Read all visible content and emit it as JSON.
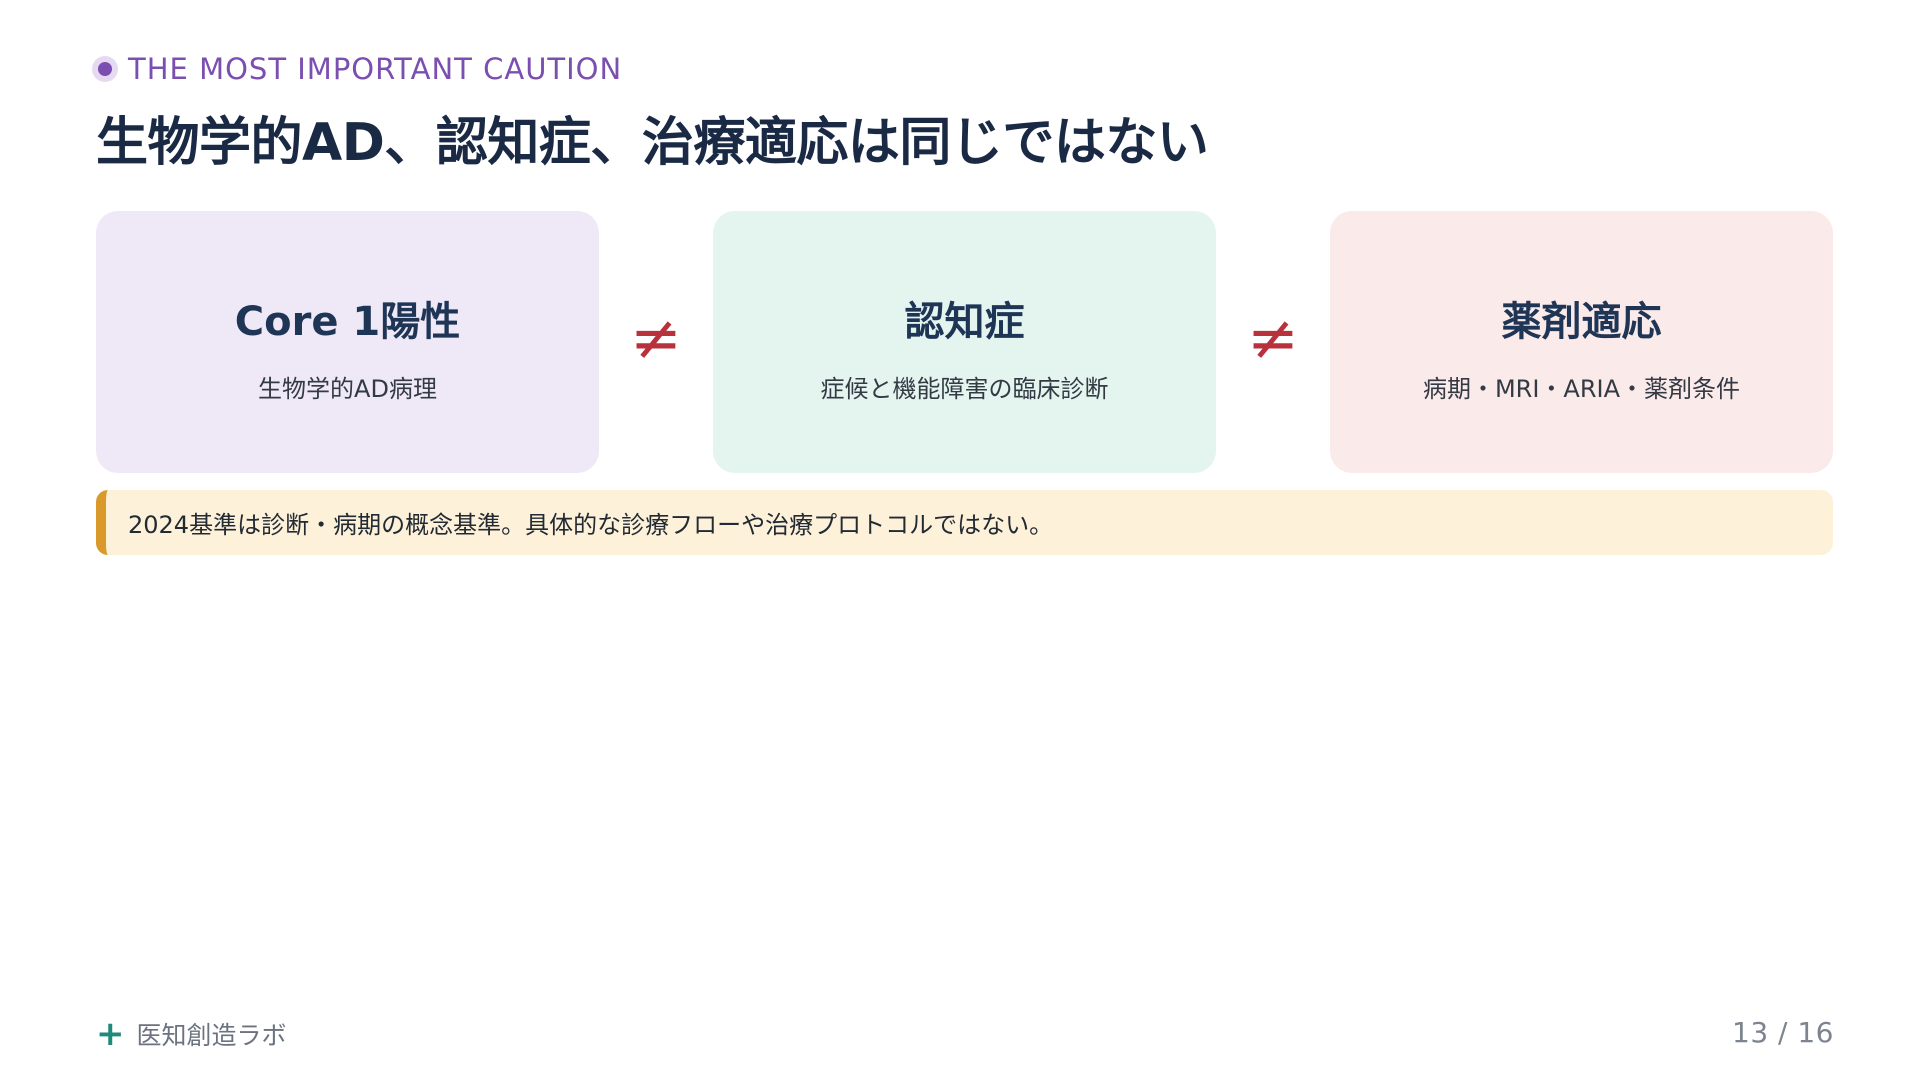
{
  "header": {
    "eyebrow": "THE MOST IMPORTANT CAUTION",
    "title": "生物学的AD、認知症、治療適応は同じではない"
  },
  "cards": [
    {
      "title": "Core 1陽性",
      "subtitle": "生物学的AD病理"
    },
    {
      "title": "認知症",
      "subtitle": "症候と機能障害の臨床診断"
    },
    {
      "title": "薬剤適応",
      "subtitle": "病期・MRI・ARIA・薬剤条件"
    }
  ],
  "separators": [
    "≠",
    "≠"
  ],
  "note": "2024基準は診断・病期の概念基準。具体的な診療フローや治療プロトコルではない。",
  "footer": {
    "brand_icon": "+",
    "brand": "医知創造ラボ",
    "page": "13 / 16"
  },
  "colors": {
    "accent_purple": "#7b4fb0",
    "title_navy": "#1a2a44",
    "neq_red": "#b8323c",
    "note_border": "#d99a2b",
    "brand_teal": "#1f8a7a"
  }
}
